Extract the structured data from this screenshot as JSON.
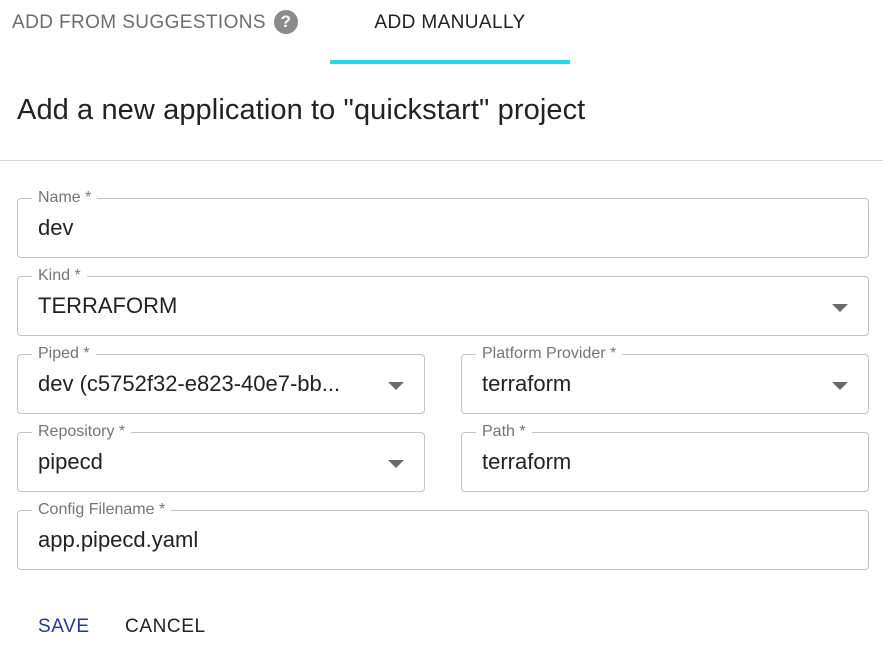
{
  "tabs": {
    "suggestions": "ADD FROM SUGGESTIONS",
    "manual": "ADD MANUALLY",
    "help_icon": "question-mark-icon",
    "accent_color": "#26d7ec"
  },
  "title": "Add a new application to \"quickstart\" project",
  "form": {
    "name": {
      "label": "Name *",
      "value": "dev"
    },
    "kind": {
      "label": "Kind *",
      "value": "TERRAFORM"
    },
    "piped": {
      "label": "Piped *",
      "value": "dev (c5752f32-e823-40e7-bb..."
    },
    "platform_provider": {
      "label": "Platform Provider *",
      "value": "terraform"
    },
    "repository": {
      "label": "Repository *",
      "value": "pipecd"
    },
    "path": {
      "label": "Path *",
      "value": "terraform"
    },
    "config_filename": {
      "label": "Config Filename *",
      "value": "app.pipecd.yaml"
    }
  },
  "actions": {
    "save": "SAVE",
    "cancel": "CANCEL",
    "save_color": "#283593"
  }
}
